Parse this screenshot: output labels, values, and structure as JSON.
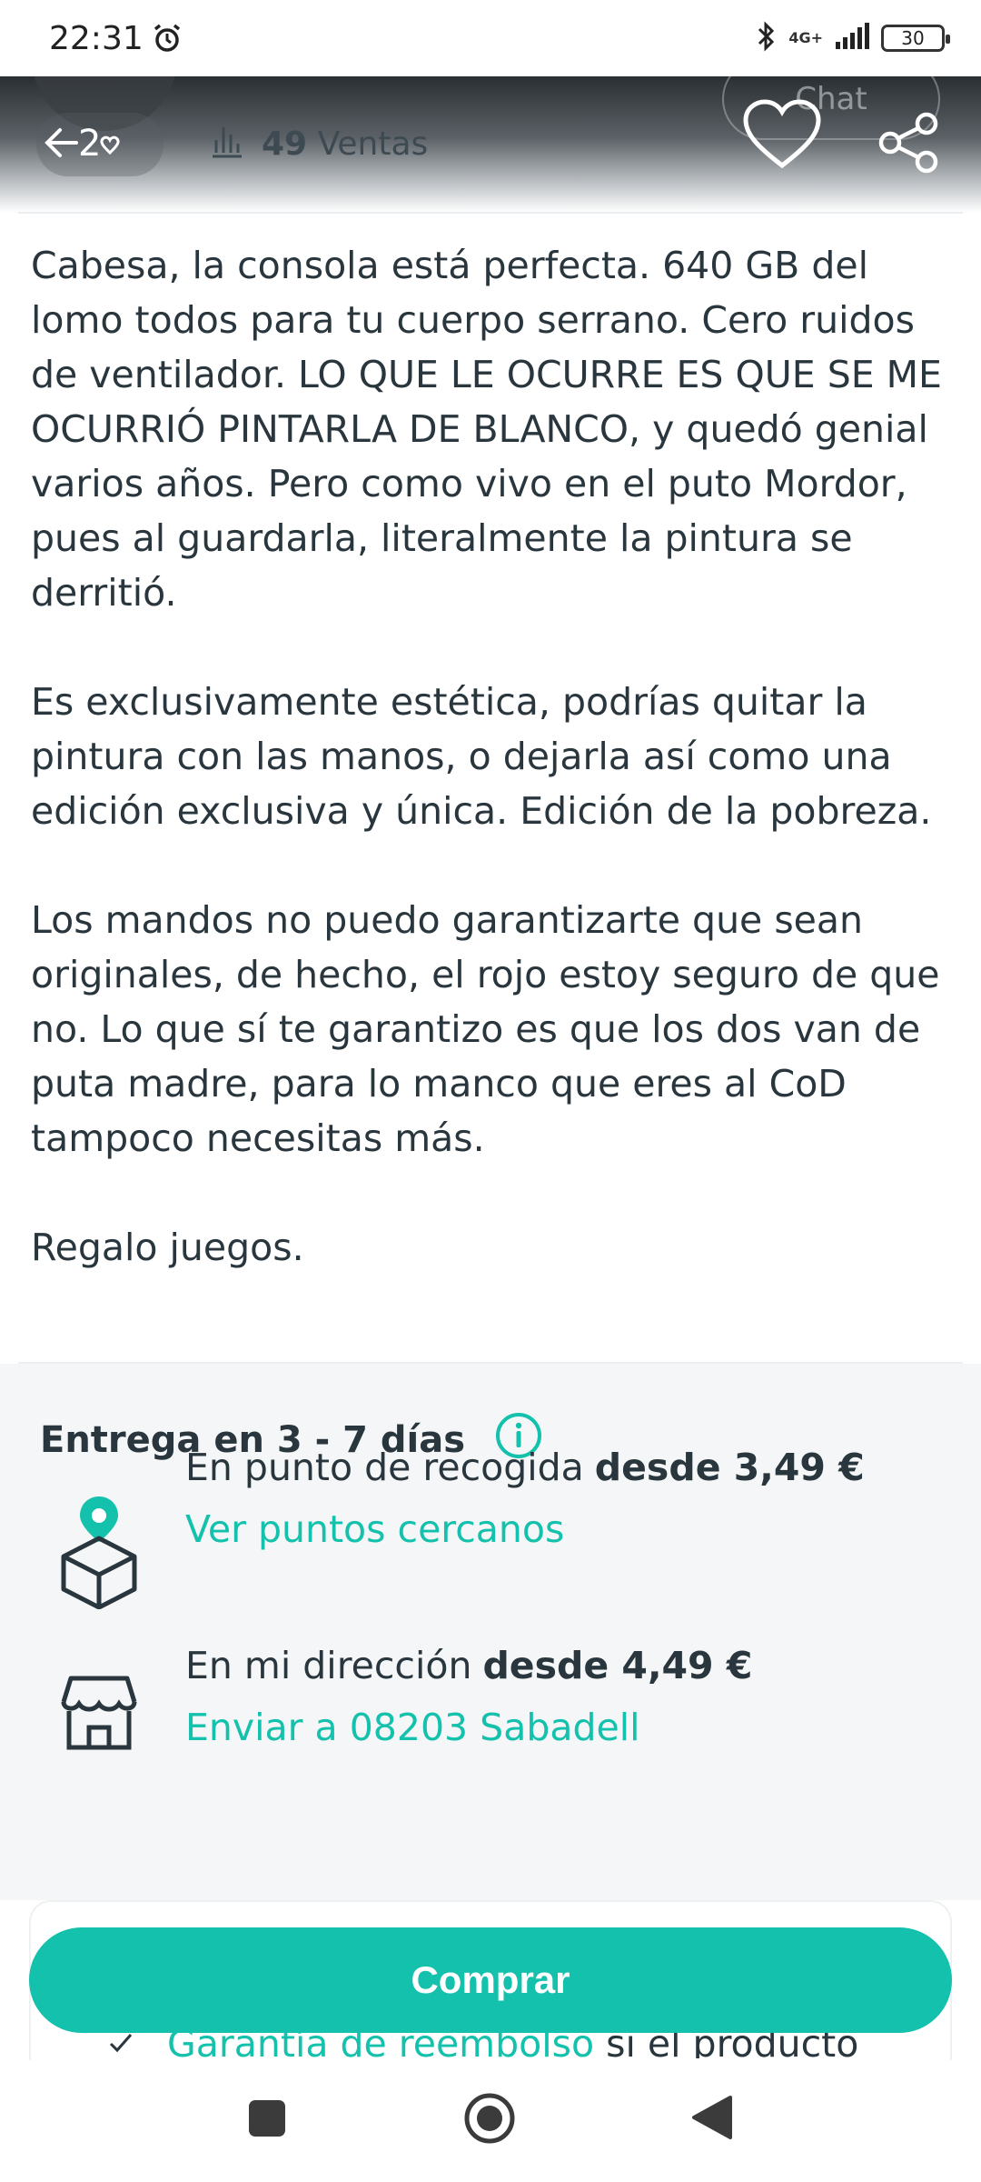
{
  "status_bar": {
    "time": "22:31",
    "network": "4G+",
    "battery": "30",
    "icons": [
      "alarm-icon",
      "bluetooth-icon",
      "signal-icon",
      "battery-icon"
    ]
  },
  "header": {
    "sales_count": "49",
    "sales_label": "Ventas",
    "chat_label": "Chat",
    "icons": [
      "back-icon",
      "favorite-icon",
      "share-icon",
      "stats-icon"
    ]
  },
  "description": {
    "paragraphs": [
      "Cabesa, la consola está perfecta. 640 GB del lomo todos para tu cuerpo serrano. Cero ruidos de ventilador. LO QUE LE OCURRE ES QUE SE ME OCURRIÓ PINTARLA DE BLANCO, y quedó genial varios años. Pero como vivo en el puto Mordor, pues al guardarla, literalmente la pintura se derritió.",
      "Es exclusivamente estética, podrías quitar la pintura con las manos, o dejarla así como una edición exclusiva y única. Edición de la pobreza.",
      "Los mandos no puedo garantizarte que sean originales, de hecho, el rojo estoy seguro de que no. Lo que sí te garantizo es que los dos van de puta madre, para lo manco que eres al CoD tampoco necesitas más.",
      "Regalo juegos."
    ]
  },
  "delivery": {
    "title": "Entrega en 3 - 7 días",
    "options": [
      {
        "label": "En punto de recogida",
        "price": "desde 3,49 €",
        "link": "Ver puntos cercanos",
        "icon": "pickup-point-icon"
      },
      {
        "label": "En mi dirección",
        "price": "desde 4,49 €",
        "link": "Enviar a 08203 Sabadell",
        "icon": "home-delivery-icon"
      }
    ]
  },
  "buy": {
    "button_label": "Comprar",
    "guarantee_link": "Garantía de reembolso",
    "guarantee_text": "si el producto"
  },
  "colors": {
    "accent": "#13c1ac",
    "text": "#29363d",
    "section_bg": "#f4f6f7"
  }
}
